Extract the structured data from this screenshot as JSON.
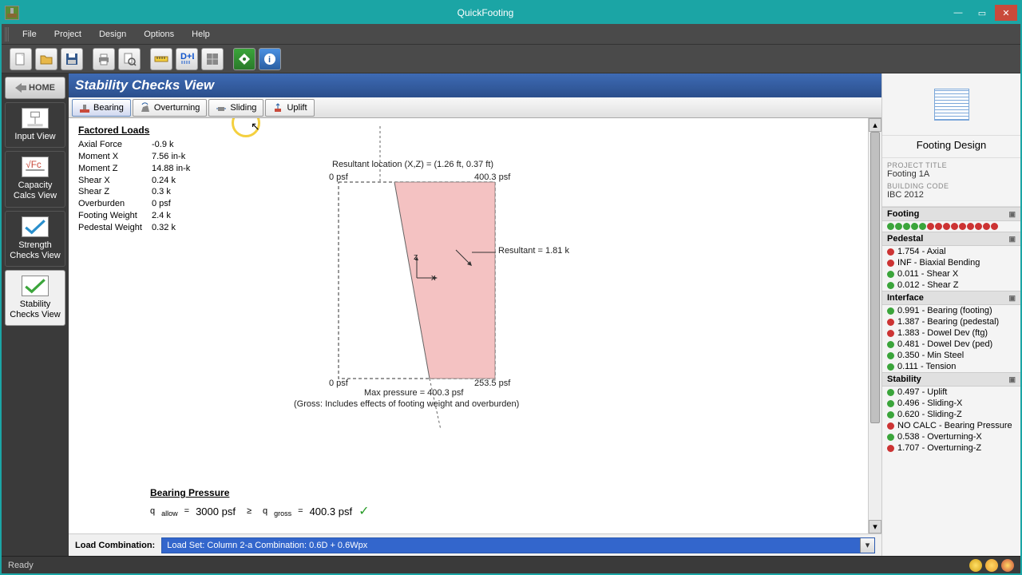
{
  "app": {
    "title": "QuickFooting"
  },
  "menu": {
    "items": [
      "File",
      "Project",
      "Design",
      "Options",
      "Help"
    ]
  },
  "home": "HOME",
  "nav": {
    "items": [
      {
        "label": "Input View"
      },
      {
        "label": "Capacity Calcs View"
      },
      {
        "label": "Strength Checks View"
      },
      {
        "label": "Stability Checks View"
      }
    ]
  },
  "view": {
    "title": "Stability Checks View"
  },
  "tabs": {
    "items": [
      "Bearing",
      "Overturning",
      "Sliding",
      "Uplift"
    ],
    "active": 0
  },
  "factored_loads": {
    "heading": "Factored Loads",
    "rows": [
      {
        "label": "Axial Force",
        "value": "-0.9 k"
      },
      {
        "label": "Moment X",
        "value": "7.56 in-k"
      },
      {
        "label": "Moment Z",
        "value": "14.88 in-k"
      },
      {
        "label": "Shear X",
        "value": "0.24 k"
      },
      {
        "label": "Shear Z",
        "value": "0.3 k"
      },
      {
        "label": "Overburden",
        "value": "0 psf"
      },
      {
        "label": "Footing Weight",
        "value": "2.4 k"
      },
      {
        "label": "Pedestal Weight",
        "value": "0.32 k"
      }
    ]
  },
  "diagram": {
    "resultant_loc": "Resultant location (X,Z) = (1.26 ft, 0.37 ft)",
    "corner_tl": "0 psf",
    "corner_tr": "400.3 psf",
    "corner_bl": "0 psf",
    "corner_br": "253.5 psf",
    "resultant": "Resultant = 1.81 k",
    "max_pressure": "Max pressure = 400.3 psf",
    "gross_note": "(Gross:  Includes effects of footing weight and overburden)",
    "z": "z",
    "x": "x"
  },
  "bearing": {
    "heading": "Bearing Pressure",
    "q_allow_label": "q",
    "q_allow_sub": "allow",
    "eq1": "=",
    "q_allow_val": "3000 psf",
    "gte": "≥",
    "q_gross_label": "q",
    "q_gross_sub": "gross",
    "eq2": "=",
    "q_gross_val": "400.3 psf"
  },
  "combo": {
    "label": "Load Combination:",
    "value": "Load Set:  Column 2-a            Combination:  0.6D + 0.6Wpx"
  },
  "right": {
    "title": "Footing Design",
    "project_title_hdr": "PROJECT TITLE",
    "project_title": "Footing 1A",
    "building_code_hdr": "BUILDING CODE",
    "building_code": "IBC 2012",
    "sections": {
      "footing": {
        "title": "Footing",
        "dots": [
          "g",
          "g",
          "g",
          "g",
          "g",
          "r",
          "r",
          "r",
          "r",
          "r",
          "r",
          "r",
          "r",
          "r"
        ]
      },
      "pedestal": {
        "title": "Pedestal",
        "items": [
          {
            "st": "r",
            "text": "1.754 - Axial"
          },
          {
            "st": "r",
            "text": "INF - Biaxial Bending"
          },
          {
            "st": "g",
            "text": "0.011 - Shear X"
          },
          {
            "st": "g",
            "text": "0.012 - Shear Z"
          }
        ]
      },
      "interface": {
        "title": "Interface",
        "items": [
          {
            "st": "g",
            "text": "0.991 - Bearing (footing)"
          },
          {
            "st": "r",
            "text": "1.387 - Bearing (pedestal)"
          },
          {
            "st": "r",
            "text": "1.383 - Dowel Dev (ftg)"
          },
          {
            "st": "g",
            "text": "0.481 - Dowel Dev (ped)"
          },
          {
            "st": "g",
            "text": "0.350 - Min Steel"
          },
          {
            "st": "g",
            "text": "0.111 - Tension"
          }
        ]
      },
      "stability": {
        "title": "Stability",
        "items": [
          {
            "st": "g",
            "text": "0.497 - Uplift"
          },
          {
            "st": "g",
            "text": "0.496 - Sliding-X"
          },
          {
            "st": "g",
            "text": "0.620 - Sliding-Z"
          },
          {
            "st": "r",
            "text": "NO CALC - Bearing Pressure"
          },
          {
            "st": "g",
            "text": "0.538 - Overturning-X"
          },
          {
            "st": "r",
            "text": "1.707 - Overturning-Z"
          }
        ]
      }
    }
  },
  "status": {
    "text": "Ready"
  }
}
